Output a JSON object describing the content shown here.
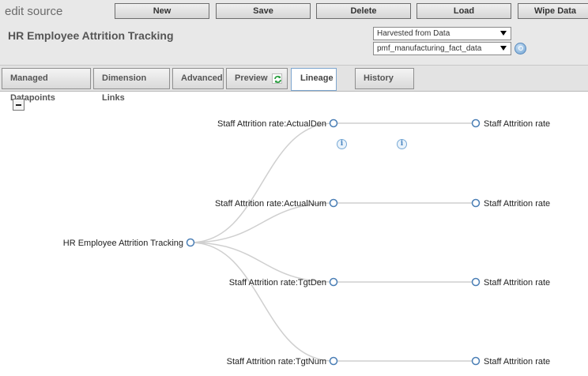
{
  "app": {
    "title": "edit source"
  },
  "source": {
    "name": "HR Employee Attrition Tracking"
  },
  "toolbar": {
    "new_label": "New",
    "save_label": "Save",
    "delete_label": "Delete",
    "load_label": "Load",
    "wipe_label": "Wipe Data"
  },
  "selectors": {
    "source_type": "Harvested from Data",
    "table": "pmf_manufacturing_fact_data"
  },
  "tabs": {
    "managed": "Managed Datapoints",
    "dimension": "Dimension Links",
    "advanced": "Advanced",
    "preview": "Preview",
    "lineage": "Lineage",
    "history": "History"
  },
  "lineage": {
    "root": "HR Employee Attrition Tracking",
    "middle": [
      "Staff Attrition rate:ActualDen",
      "Staff Attrition rate:ActualNum",
      "Staff Attrition rate:TgtDen",
      "Staff Attrition rate:TgtNum"
    ],
    "right": [
      "Staff Attrition rate",
      "Staff Attrition rate",
      "Staff Attrition rate",
      "Staff Attrition rate"
    ]
  },
  "colors": {
    "node_stroke": "#4a7eb5",
    "link": "#cfcfcf"
  }
}
